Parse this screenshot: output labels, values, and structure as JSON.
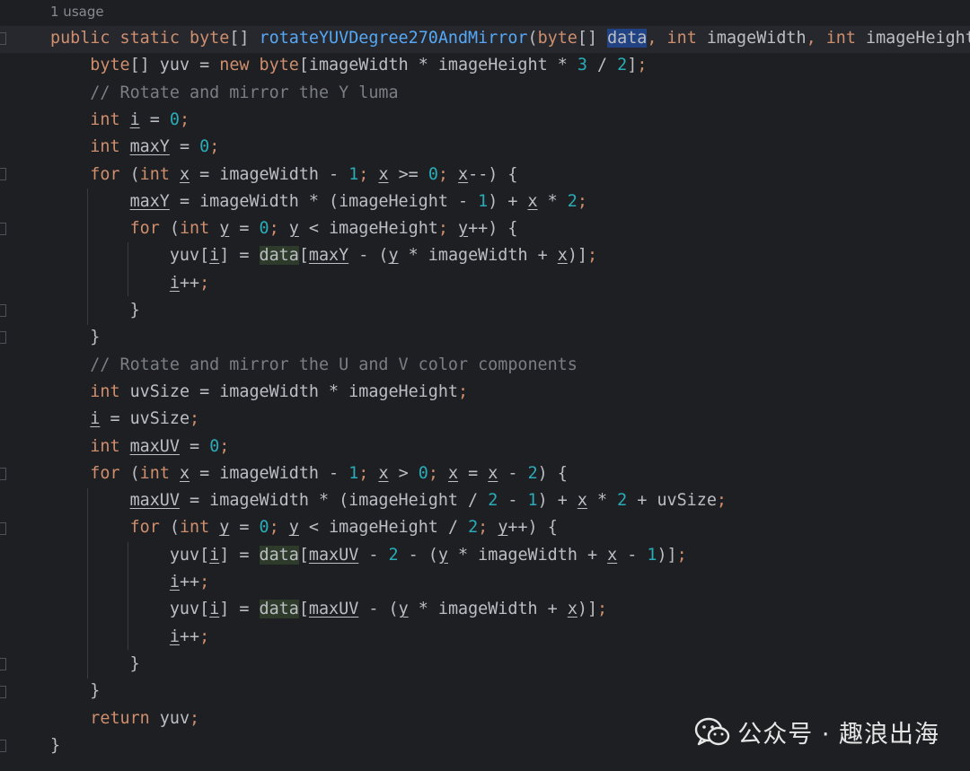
{
  "editor": {
    "usage_hint": "1 usage",
    "lines": [
      "public static byte[] rotateYUVDegree270AndMirror(byte[] data, int imageWidth, int imageHeight",
      "    byte[] yuv = new byte[imageWidth * imageHeight * 3 / 2];",
      "    // Rotate and mirror the Y luma",
      "    int i = 0;",
      "    int maxY = 0;",
      "    for (int x = imageWidth - 1; x >= 0; x--) {",
      "        maxY = imageWidth * (imageHeight - 1) + x * 2;",
      "        for (int y = 0; y < imageHeight; y++) {",
      "            yuv[i] = data[maxY - (y * imageWidth + x)];",
      "            i++;",
      "        }",
      "    }",
      "    // Rotate and mirror the U and V color components",
      "    int uvSize = imageWidth * imageHeight;",
      "    i = uvSize;",
      "    int maxUV = 0;",
      "    for (int x = imageWidth - 1; x > 0; x = x - 2) {",
      "        maxUV = imageWidth * (imageHeight / 2 - 1) + x * 2 + uvSize;",
      "        for (int y = 0; y < imageHeight / 2; y++) {",
      "            yuv[i] = data[maxUV - 2 - (y * imageWidth + x - 1)];",
      "            i++;",
      "            yuv[i] = data[maxUV - (y * imageWidth + x)];",
      "            i++;",
      "        }",
      "    }",
      "    return yuv;",
      "}"
    ]
  },
  "watermark": {
    "text": "公众号 · 趣浪出海",
    "icon": "wechat-icon"
  },
  "colors": {
    "background": "#1e1f22",
    "keyword": "#cf8e6d",
    "function": "#56a8f5",
    "number": "#2aacb8",
    "comment": "#7a7e85",
    "text": "#bcbec4",
    "selection": "#214283"
  }
}
